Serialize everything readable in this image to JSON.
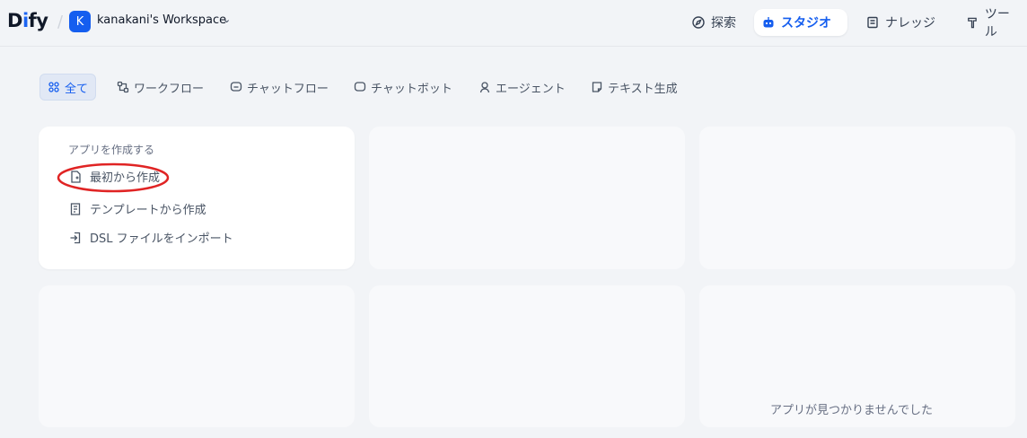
{
  "header": {
    "logo_main": "D",
    "logo_accent": "i",
    "logo_rest": "fy",
    "workspace_initial": "K",
    "workspace_name": "kanakani's Workspace",
    "nav": [
      {
        "label": "探索",
        "icon": "explore-icon"
      },
      {
        "label": "スタジオ",
        "icon": "robot-icon",
        "active": true
      },
      {
        "label": "ナレッジ",
        "icon": "book-icon"
      },
      {
        "label": "ツール",
        "icon": "hammer-icon"
      }
    ]
  },
  "tabs": [
    {
      "label": "全て",
      "icon": "grid-icon",
      "active": true
    },
    {
      "label": "ワークフロー",
      "icon": "workflow-icon"
    },
    {
      "label": "チャットフロー",
      "icon": "chatflow-icon"
    },
    {
      "label": "チャットボット",
      "icon": "chat-icon"
    },
    {
      "label": "エージェント",
      "icon": "agent-icon"
    },
    {
      "label": "テキスト生成",
      "icon": "text-gen-icon"
    }
  ],
  "create_card": {
    "title": "アプリを作成する",
    "items": [
      {
        "label": "最初から作成",
        "icon": "file-plus-icon"
      },
      {
        "label": "テンプレートから作成",
        "icon": "template-icon"
      },
      {
        "label": "DSL ファイルをインポート",
        "icon": "import-icon"
      }
    ]
  },
  "empty_state": "アプリが見つかりませんでした",
  "colors": {
    "accent": "#155eef",
    "background": "#f2f4f7",
    "annotation": "#e02424"
  }
}
